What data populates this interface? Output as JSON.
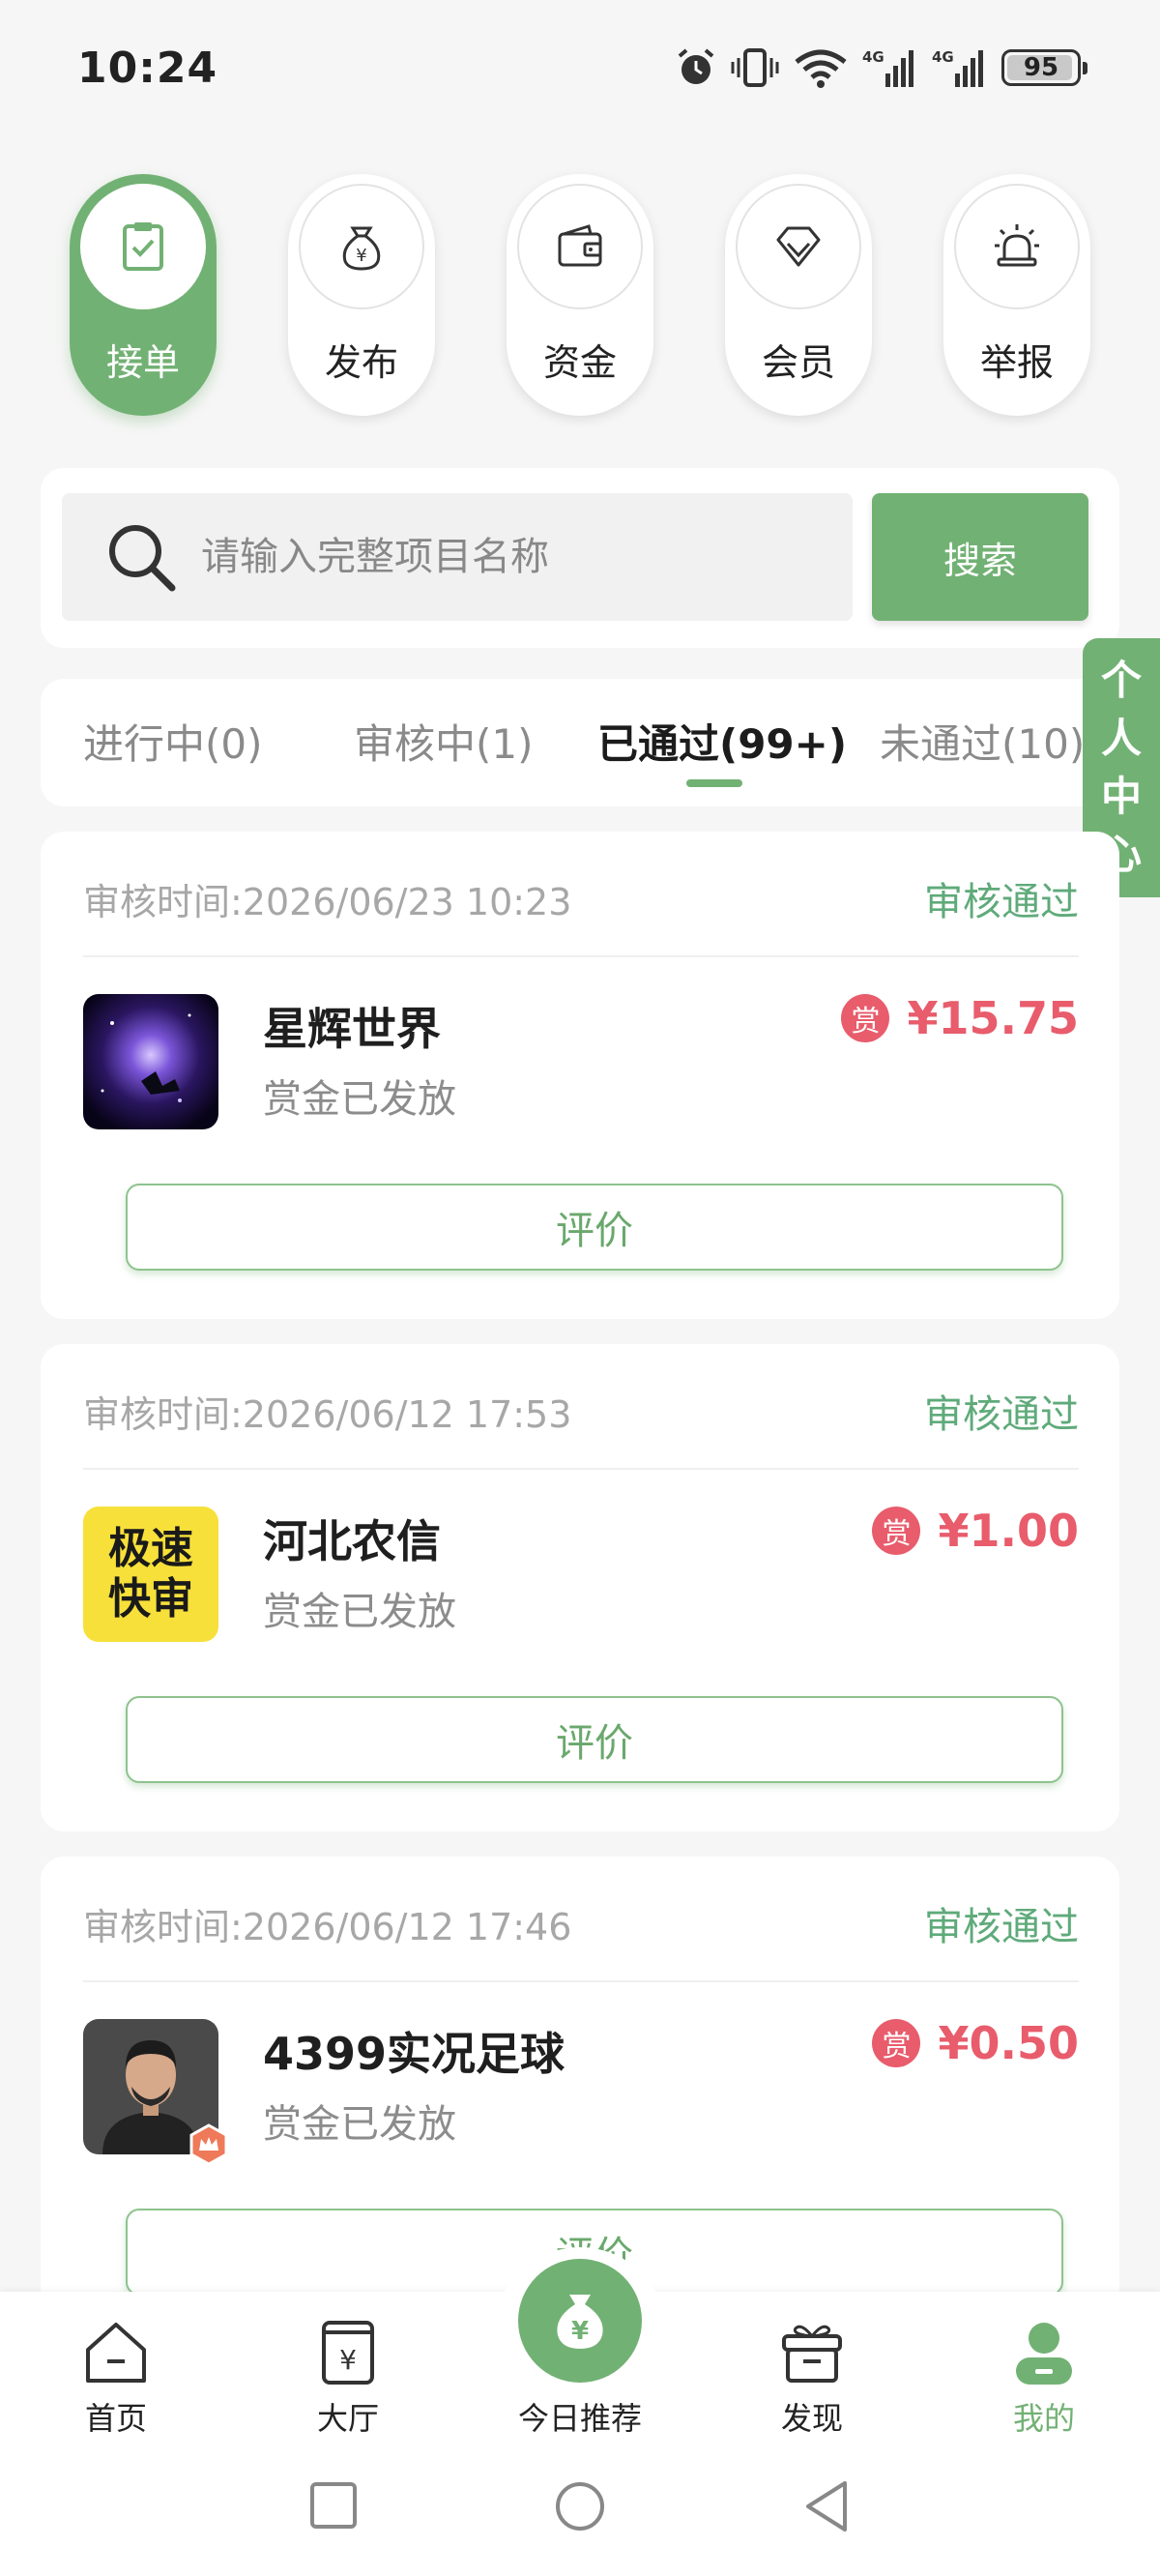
{
  "status_bar": {
    "time": "10:24",
    "battery": "95",
    "battery_level_percent": 95,
    "icons": [
      "alarm-icon",
      "vibrate-icon",
      "wifi-icon",
      "signal-4g-icon",
      "signal-4g-icon",
      "battery-icon"
    ]
  },
  "categories": [
    {
      "label": "接单",
      "icon": "clipboard-check-icon",
      "active": true
    },
    {
      "label": "发布",
      "icon": "money-bag-icon",
      "active": false
    },
    {
      "label": "资金",
      "icon": "wallet-icon",
      "active": false
    },
    {
      "label": "会员",
      "icon": "diamond-icon",
      "active": false
    },
    {
      "label": "举报",
      "icon": "alarm-light-icon",
      "active": false
    }
  ],
  "search": {
    "placeholder": "请输入完整项目名称",
    "value": "",
    "button_label": "搜索"
  },
  "tabs": [
    {
      "label": "进行中(0)",
      "active": false
    },
    {
      "label": "审核中(1)",
      "active": false
    },
    {
      "label": "已通过(99+)",
      "active": true
    },
    {
      "label": "未通过(10)",
      "active": false
    }
  ],
  "side_tab": {
    "label": "个人中心"
  },
  "records": [
    {
      "time": "审核时间:2026/06/23 10:23",
      "status": "审核通过",
      "name": "星辉世界",
      "sub": "赏金已发放",
      "reward_badge": "赏",
      "amount": "¥15.75",
      "button": "评价",
      "thumb": "galaxy-thumbnail"
    },
    {
      "time": "审核时间:2026/06/12 17:53",
      "status": "审核通过",
      "name": "河北农信",
      "sub": "赏金已发放",
      "reward_badge": "赏",
      "amount": "¥1.00",
      "button": "评价",
      "thumb": "logo-thumbnail",
      "thumb_text": [
        "极速",
        "快审"
      ]
    },
    {
      "time": "审核时间:2026/06/12 17:46",
      "status": "审核通过",
      "name": "4399实况足球",
      "sub": "赏金已发放",
      "reward_badge": "赏",
      "amount": "¥0.50",
      "button": "评价",
      "thumb": "avatar-thumbnail"
    }
  ],
  "bottom_nav": [
    {
      "label": "首页",
      "icon": "home-icon",
      "active": false
    },
    {
      "label": "大厅",
      "icon": "yen-ticket-icon",
      "active": false
    },
    {
      "label": "今日推荐",
      "icon": "money-bag-icon",
      "active": false,
      "center": true
    },
    {
      "label": "发现",
      "icon": "gift-box-icon",
      "active": false
    },
    {
      "label": "我的",
      "icon": "user-icon",
      "active": true
    }
  ],
  "colors": {
    "accent": "#72b174",
    "reward": "#e85c6c",
    "status_pass": "#5faa7a",
    "background": "#f6f6f6"
  }
}
